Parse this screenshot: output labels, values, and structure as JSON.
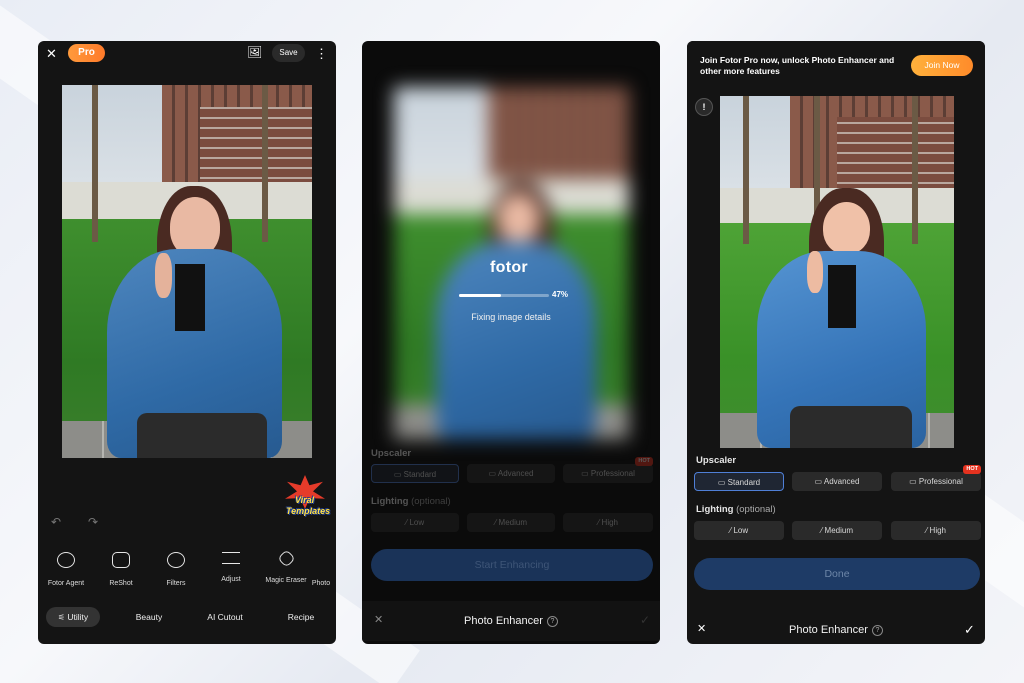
{
  "phone1": {
    "close_icon": "✕",
    "pro_label": "Pro",
    "save_label": "Save",
    "more_icon": "⋮",
    "image_icon": "🖼",
    "sticker": {
      "line1": "Viral",
      "line2": "Templates"
    },
    "undo_icon": "↶",
    "redo_icon": "↷",
    "tools": [
      "Fotor Agent",
      "ReShot",
      "Filters",
      "Adjust",
      "Magic Eraser",
      "Photo"
    ],
    "tabs": [
      "Utility",
      "Beauty",
      "AI Cutout",
      "Recipe"
    ]
  },
  "phone2": {
    "logo": "fotor",
    "progress_text": "47%",
    "progress_fraction": 0.47,
    "status": "Fixing image details",
    "upscaler_label": "Upscaler",
    "upscaler_options": [
      "Standard",
      "Advanced",
      "Professional"
    ],
    "hot_label": "HOT",
    "lighting_label": "Lighting",
    "lighting_optional": "(optional)",
    "lighting_options": [
      "Low",
      "Medium",
      "High"
    ],
    "action_button": "Start Enhancing",
    "bottom_title": "Photo Enhancer",
    "help_icon": "?",
    "close_icon": "✕",
    "confirm_icon": "✓"
  },
  "phone3": {
    "banner_text": "Join Fotor Pro now, unlock Photo Enhancer and other more features",
    "join_button": "Join Now",
    "info_icon": "!",
    "upscaler_label": "Upscaler",
    "upscaler_options": [
      "Standard",
      "Advanced",
      "Professional"
    ],
    "hot_label": "HOT",
    "lighting_label": "Lighting",
    "lighting_optional": "(optional)",
    "lighting_options": [
      "Low",
      "Medium",
      "High"
    ],
    "action_button": "Done",
    "bottom_title": "Photo Enhancer",
    "help_icon": "?",
    "close_icon": "✕",
    "confirm_icon": "✓"
  },
  "colors": {
    "accent_orange": "#ff8b2a",
    "selected_border": "#4f7fd6",
    "button_blue": "#1e3b66"
  }
}
